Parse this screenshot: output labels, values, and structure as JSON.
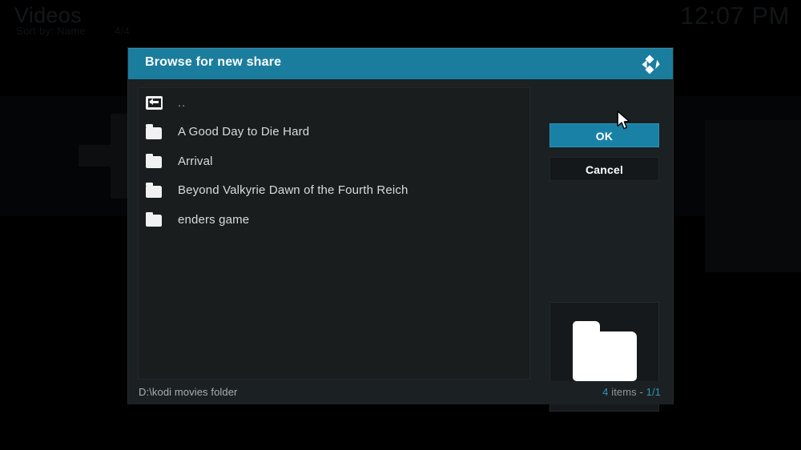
{
  "background": {
    "title": "Videos",
    "sort_label": "Sort by: Name",
    "item_count": "4/4",
    "clock": "12:07 PM"
  },
  "dialog": {
    "title": "Browse for new share",
    "logo_icon": "kodi-logo-icon",
    "file_list": [
      {
        "label": "..",
        "icon": "parent-directory-icon",
        "dim": true
      },
      {
        "label": "A Good Day to Die Hard",
        "icon": "folder-icon",
        "dim": false
      },
      {
        "label": "Arrival",
        "icon": "folder-icon",
        "dim": false
      },
      {
        "label": "Beyond Valkyrie Dawn of the Fourth Reich",
        "icon": "folder-icon",
        "dim": false
      },
      {
        "label": "enders game",
        "icon": "folder-icon",
        "dim": false
      }
    ],
    "buttons": {
      "ok_label": "OK",
      "cancel_label": "Cancel"
    },
    "preview": {
      "icon": "folder-icon"
    },
    "status": {
      "path": "D:\\kodi movies folder",
      "count_number": "4",
      "count_label": " items - ",
      "page": "1/1"
    }
  },
  "colors": {
    "accent": "#1a7d9e",
    "accent_button": "#1a81a6",
    "dialog_bg": "#1b2023",
    "list_bg": "#191d1e",
    "status_accent": "#2f94b8"
  }
}
